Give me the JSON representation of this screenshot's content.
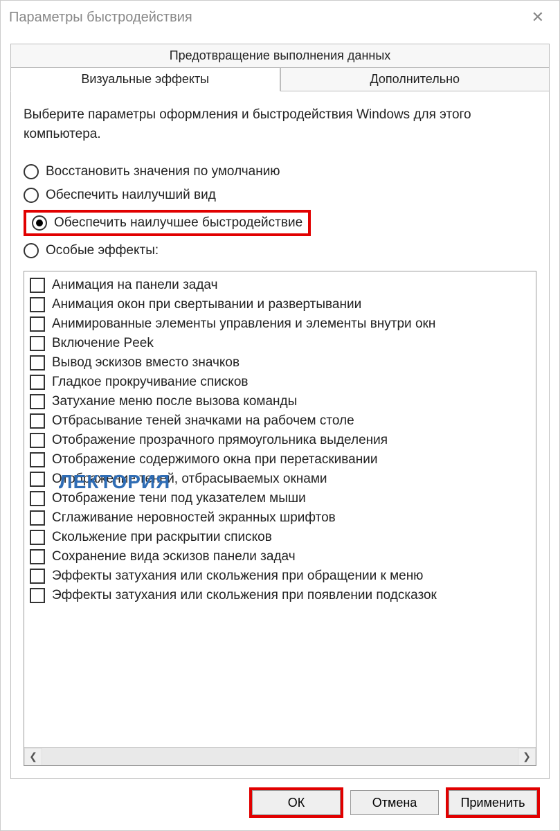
{
  "window": {
    "title": "Параметры быстродействия"
  },
  "tabs": {
    "top": "Предотвращение выполнения данных",
    "left": "Визуальные эффекты",
    "right": "Дополнительно"
  },
  "intro": "Выберите параметры оформления и быстродействия Windows для этого компьютера.",
  "radios": [
    {
      "label": "Восстановить значения по умолчанию",
      "selected": false
    },
    {
      "label": "Обеспечить наилучший вид",
      "selected": false
    },
    {
      "label": "Обеспечить наилучшее быстродействие",
      "selected": true,
      "highlighted": true
    },
    {
      "label": "Особые эффекты:",
      "selected": false
    }
  ],
  "checks": [
    "Анимация на панели задач",
    "Анимация окон при свертывании и развертывании",
    "Анимированные элементы управления и элементы внутри окн",
    "Включение Peek",
    "Вывод эскизов вместо значков",
    "Гладкое прокручивание списков",
    "Затухание меню после вызова команды",
    "Отбрасывание теней значками на рабочем столе",
    "Отображение прозрачного прямоугольника выделения",
    "Отображение содержимого окна при перетаскивании",
    "Отображение теней, отбрасываемых окнами",
    "Отображение тени под указателем мыши",
    "Сглаживание неровностей экранных шрифтов",
    "Скольжение при раскрытии списков",
    "Сохранение вида эскизов панели задач",
    "Эффекты затухания или скольжения при обращении к меню",
    "Эффекты затухания или скольжения при появлении подсказок"
  ],
  "buttons": {
    "ok": "ОК",
    "cancel": "Отмена",
    "apply": "Применить"
  },
  "watermark": "ЛЕКТОРИЯ"
}
